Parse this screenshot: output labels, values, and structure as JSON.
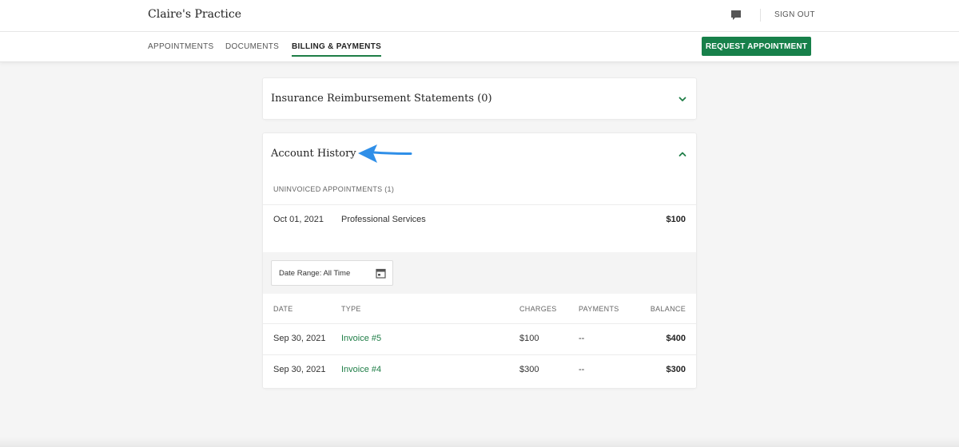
{
  "header": {
    "practice_name": "Claire's Practice",
    "chat_icon": "chat-bubble-icon",
    "sign_out_label": "SIGN OUT"
  },
  "nav": {
    "tabs": [
      {
        "label": "APPOINTMENTS",
        "active": false
      },
      {
        "label": "DOCUMENTS",
        "active": false
      },
      {
        "label": "BILLING & PAYMENTS",
        "active": true
      }
    ],
    "request_button_label": "REQUEST APPOINTMENT"
  },
  "insurance_section": {
    "title": "Insurance Reimbursement Statements (0)",
    "expanded": false,
    "icon": "chevron-down-icon"
  },
  "account_history": {
    "title": "Account History",
    "expanded": true,
    "icon": "chevron-up-icon",
    "uninvoiced_label": "UNINVOICED APPOINTMENTS (1)",
    "uninvoiced": [
      {
        "date": "Oct 01, 2021",
        "description": "Professional Services",
        "amount": "$100"
      }
    ],
    "date_range": {
      "label": "Date Range: All Time",
      "icon": "calendar-icon"
    },
    "columns": [
      "DATE",
      "TYPE",
      "CHARGES",
      "PAYMENTS",
      "BALANCE"
    ],
    "rows": [
      {
        "date": "Sep 30, 2021",
        "type": "Invoice #5",
        "charges": "$100",
        "payments": "--",
        "balance": "$400"
      },
      {
        "date": "Sep 30, 2021",
        "type": "Invoice #4",
        "charges": "$300",
        "payments": "--",
        "balance": "$300"
      }
    ]
  },
  "annotation": {
    "icon": "arrow-left-icon",
    "color": "#2f8fe8"
  },
  "colors": {
    "accent": "#17804a",
    "link": "#1e7d46"
  }
}
